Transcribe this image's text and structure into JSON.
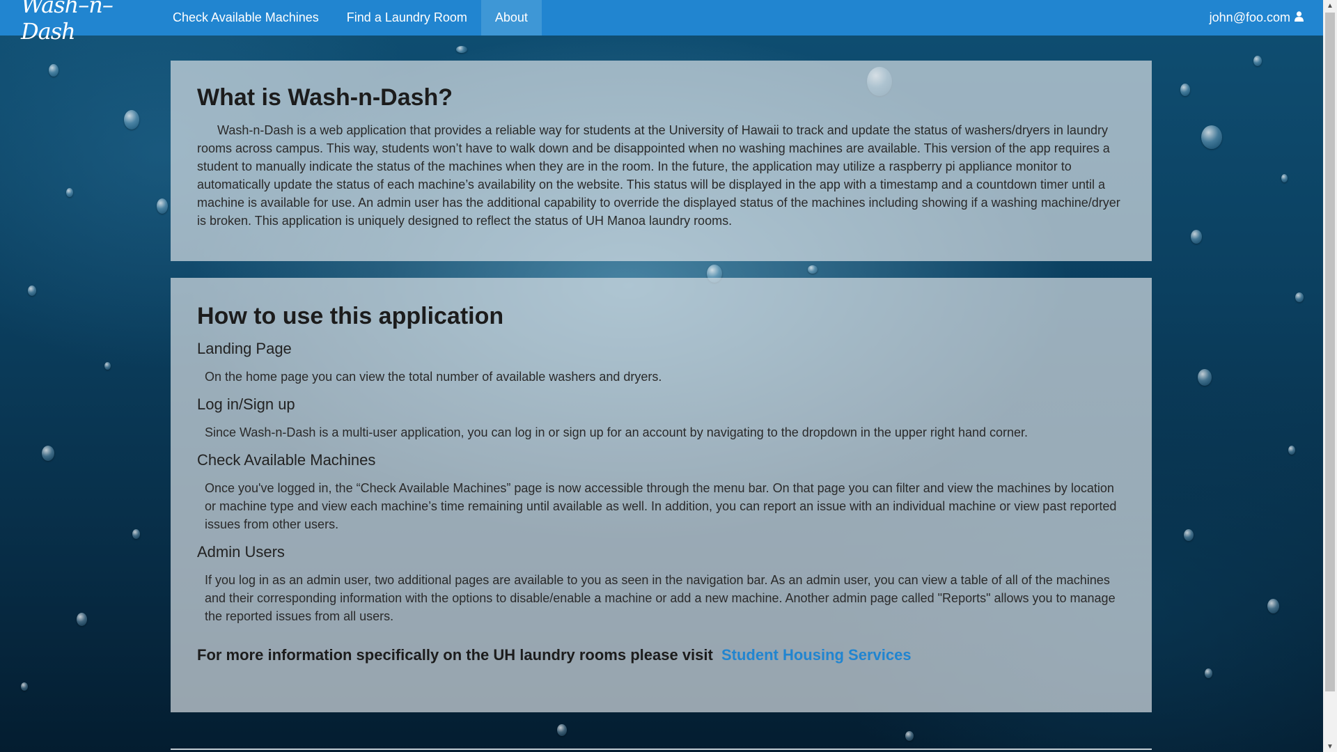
{
  "navbar": {
    "brand": "Wash–n–Dash",
    "items": [
      {
        "label": "Check Available Machines"
      },
      {
        "label": "Find a Laundry Room"
      },
      {
        "label": "About"
      }
    ],
    "active": "About",
    "user_email": "john@foo.com",
    "user_icon": "user-icon"
  },
  "about": {
    "title": "What is Wash-n-Dash?",
    "body": "Wash-n-Dash is a web application that provides a reliable way for students at the University of Hawaii to track and update the status of washers/dryers in laundry rooms across campus. This way, students won’t have to walk down and be disappointed when no washing machines are available. This version of the app requires a student to manually indicate the status of the machines when they are in the room. In the future, the application may utilize a raspberry pi appliance monitor to automatically update the status of each machine’s availability on the website. This status will be displayed in the app with a timestamp and a countdown timer until a machine is available for use. An admin user has the additional capability to override the displayed status of the machines including showing if a washing machine/dryer is broken. This application is uniquely designed to reflect the status of UH Manoa laundry rooms."
  },
  "howto": {
    "title": "How to use this application",
    "sections": [
      {
        "heading": "Landing Page",
        "text": "On the home page you can view the total number of available washers and dryers."
      },
      {
        "heading": "Log in/Sign up",
        "text": "Since Wash-n-Dash is a multi-user application, you can log in or sign up for an account by navigating to the dropdown in the upper right hand corner."
      },
      {
        "heading": "Check Available Machines",
        "text": "Once you've logged in, the “Check Available Machines” page is now accessible through the menu bar. On that page you can filter and view the machines by location or machine type and view each machine’s time remaining until available as well. In addition, you can report an issue with an individual machine or view past reported issues from other users."
      },
      {
        "heading": "Admin Users",
        "text": "If you log in as an admin user, two additional pages are available to you as seen in the navigation bar. As an admin user, you can view a table of all of the machines and their corresponding information with the options to disable/enable a machine or add a new machine. Another admin page called \"Reports\" allows you to manage the reported issues from all users."
      }
    ],
    "footer_text": "For more information specifically on the UH laundry rooms please visit",
    "footer_link": "Student Housing Services"
  },
  "colors": {
    "navbar": "#2185d0",
    "navbar_active": "#3e97d6",
    "link": "#2185d0"
  }
}
